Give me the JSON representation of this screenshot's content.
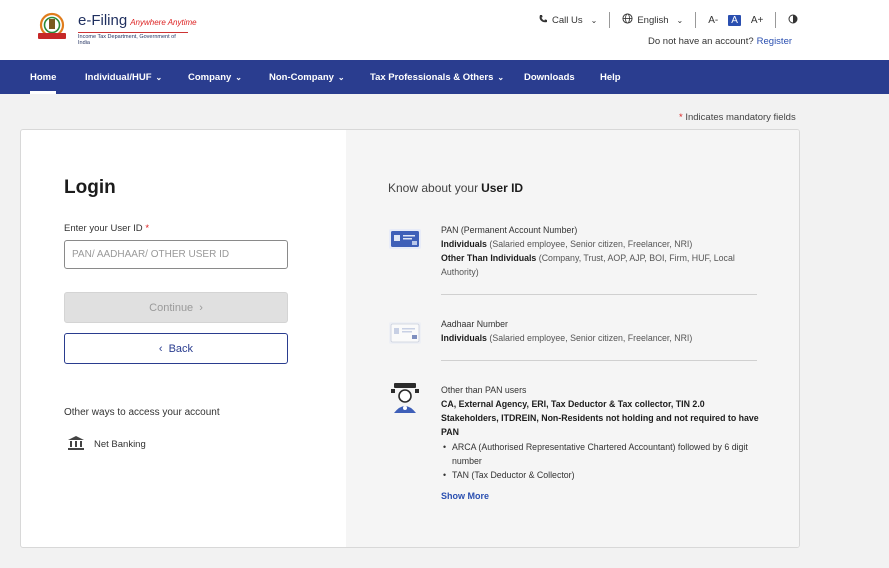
{
  "brand": {
    "title": "e-Filing",
    "tagline": "Anywhere Anytime",
    "subtitle": "Income Tax Department, Government of India",
    "emblem_icon": "national-emblem-icon"
  },
  "topbar": {
    "call_us": "Call Us",
    "language": "English",
    "font_decrease": "A-",
    "font_normal": "A",
    "font_increase": "A+",
    "account_prompt": "Do not have an account?",
    "register_label": "Register"
  },
  "nav": {
    "items": [
      {
        "label": "Home",
        "dropdown": false
      },
      {
        "label": "Individual/HUF",
        "dropdown": true
      },
      {
        "label": "Company",
        "dropdown": true
      },
      {
        "label": "Non-Company",
        "dropdown": true
      },
      {
        "label": "Tax Professionals & Others",
        "dropdown": true
      },
      {
        "label": "Downloads",
        "dropdown": false
      },
      {
        "label": "Help",
        "dropdown": false
      }
    ]
  },
  "mandatory_note": "Indicates mandatory fields",
  "login": {
    "title": "Login",
    "userid_label": "Enter your User ID",
    "userid_placeholder": "PAN/ AADHAAR/ OTHER USER ID",
    "userid_value": "",
    "continue_label": "Continue",
    "back_label": "Back",
    "other_ways": "Other ways to access your account",
    "net_banking": "Net Banking"
  },
  "know": {
    "prefix": "Know about your",
    "highlight": "User ID",
    "pan": {
      "title": "PAN (Permanent Account Number)",
      "ind_label": "Individuals",
      "ind_desc": "(Salaried employee, Senior citizen, Freelancer, NRI)",
      "other_label": "Other Than Individuals",
      "other_desc": "(Company, Trust, AOP, AJP, BOI, Firm, HUF, Local Authority)"
    },
    "aadhaar": {
      "title": "Aadhaar Number",
      "ind_label": "Individuals",
      "ind_desc": "(Salaried employee, Senior citizen, Freelancer, NRI)"
    },
    "other_users": {
      "title": "Other than PAN users",
      "desc": "CA, External Agency, ERI, Tax Deductor & Tax collector, TIN 2.0 Stakeholders, ITDREIN, Non-Residents not holding and not required to have PAN",
      "bullets": [
        "ARCA (Authorised Representative Chartered Accountant) followed by 6 digit number",
        "TAN (Tax Deductor & Collector)"
      ]
    },
    "show_more": "Show More"
  },
  "colors": {
    "nav_bg": "#2a3d8f",
    "link": "#2a4fb0",
    "required": "#d22222",
    "right_pane_bg": "#f5f5f5"
  }
}
